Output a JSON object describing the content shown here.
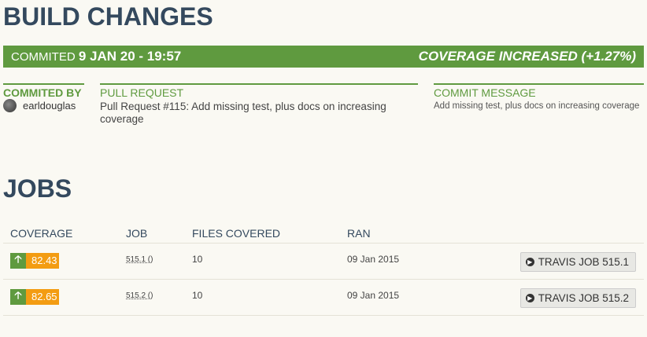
{
  "page_title": "BUILD CHANGES",
  "commit_bar": {
    "committed_label": "COMMITED",
    "committed_date": "9 JAN 20 - 19:57",
    "coverage_status": "COVERAGE INCREASED (+1.27%)"
  },
  "committed_by": {
    "label": "COMMITED BY",
    "author": "earldouglas"
  },
  "pull_request": {
    "label": "PULL REQUEST",
    "text": "Pull Request #115: Add missing test, plus docs on increasing coverage"
  },
  "commit_message": {
    "label": "COMMIT MESSAGE",
    "text": "Add missing test, plus docs on increasing coverage"
  },
  "jobs": {
    "title": "JOBS",
    "headers": {
      "coverage": "COVERAGE",
      "job": "JOB",
      "files_covered": "FILES COVERED",
      "ran": "RAN"
    },
    "rows": [
      {
        "coverage": "82.43",
        "job": "515.1 ()",
        "files_covered": "10",
        "ran": "09 Jan 2015",
        "button": "TRAVIS JOB 515.1"
      },
      {
        "coverage": "82.65",
        "job": "515.2 ()",
        "files_covered": "10",
        "ran": "09 Jan 2015",
        "button": "TRAVIS JOB 515.2"
      }
    ]
  },
  "colors": {
    "accent_green": "#5f9a3f",
    "coverage_orange": "#f39c12",
    "heading_dark": "#34495e"
  },
  "icons": {
    "coverage_up": "arrow-up-icon",
    "travis_button": "arrow-circle-right-icon"
  }
}
